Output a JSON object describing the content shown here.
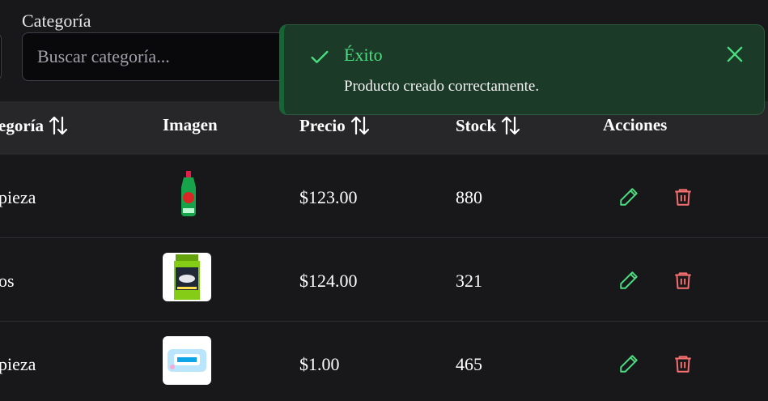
{
  "filters": {
    "category_label": "Categoría",
    "category_placeholder": "Buscar categoría..."
  },
  "table": {
    "headers": {
      "category": "egoría",
      "image": "Imagen",
      "price": "Precio",
      "stock": "Stock",
      "actions": "Acciones"
    },
    "rows": [
      {
        "category": "pieza",
        "image": "green-detergent-bottle",
        "price": "$123.00",
        "stock": "880"
      },
      {
        "category": "os",
        "image": "green-shampoo-bottle",
        "price": "$124.00",
        "stock": "321"
      },
      {
        "category": "pieza",
        "image": "wet-wipes-package",
        "price": "$1.00",
        "stock": "465"
      }
    ]
  },
  "toast": {
    "title": "Éxito",
    "message": "Producto creado correctamente."
  },
  "colors": {
    "background": "#18181b",
    "header_bg": "#27272a",
    "edit": "#4ade80",
    "delete": "#f87171",
    "toast_bg": "#1c3a28"
  }
}
